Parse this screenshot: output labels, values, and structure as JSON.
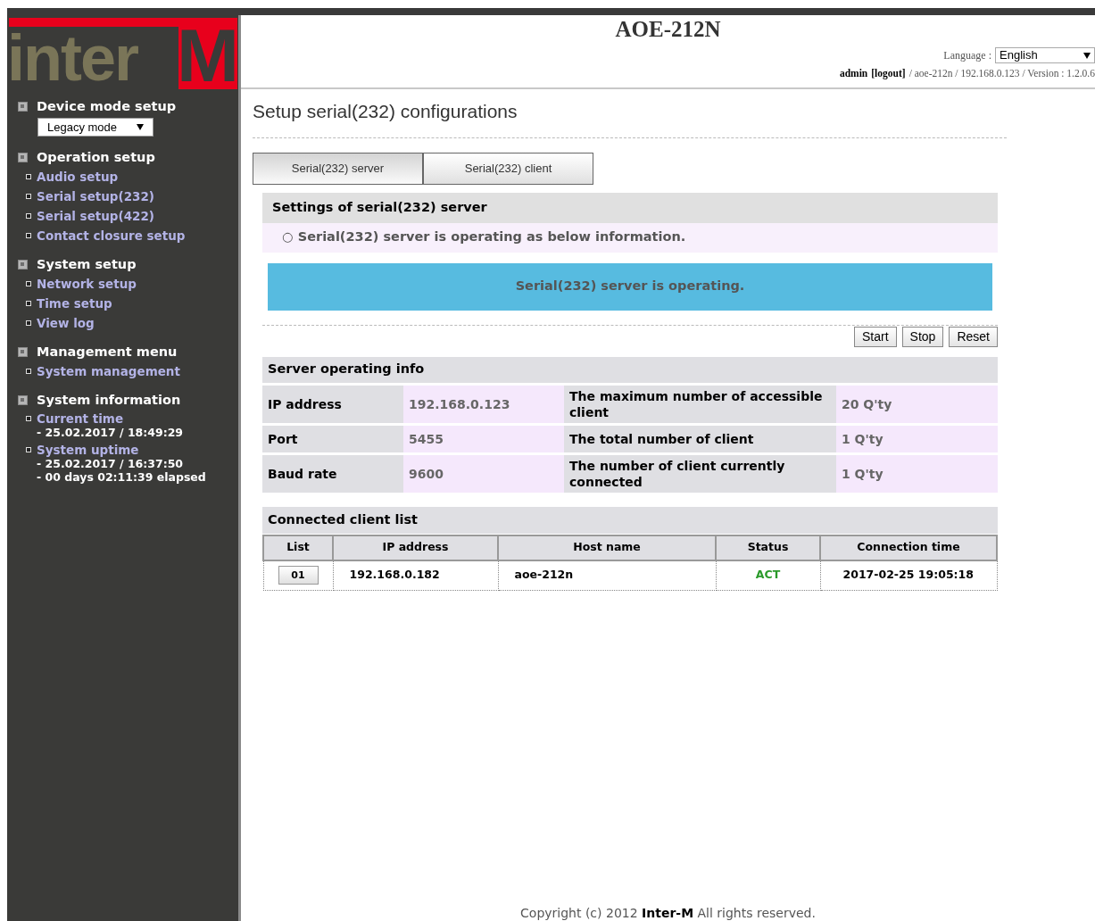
{
  "logo": {
    "text": "inter",
    "accent": "M"
  },
  "sidebar": {
    "sections": [
      {
        "title": "Device mode setup",
        "dropdown": {
          "value": "Legacy mode"
        }
      },
      {
        "title": "Operation setup",
        "items": [
          {
            "kind": "link",
            "label": "Audio setup"
          },
          {
            "kind": "link",
            "label": "Serial setup(232)"
          },
          {
            "kind": "link",
            "label": "Serial setup(422)"
          },
          {
            "kind": "link",
            "label": "Contact closure setup"
          }
        ]
      },
      {
        "title": "System setup",
        "items": [
          {
            "kind": "link",
            "label": "Network setup"
          },
          {
            "kind": "link",
            "label": "Time setup"
          },
          {
            "kind": "link",
            "label": "View log"
          }
        ]
      },
      {
        "title": "Management menu",
        "items": [
          {
            "kind": "link",
            "label": "System management"
          }
        ]
      },
      {
        "title": "System information",
        "items": [
          {
            "kind": "info",
            "label": "Current time",
            "lines": [
              "- 25.02.2017 / 18:49:29"
            ]
          },
          {
            "kind": "info",
            "label": "System uptime",
            "lines": [
              "- 25.02.2017 / 16:37:50",
              "- 00 days 02:11:39 elapsed"
            ]
          }
        ]
      }
    ]
  },
  "header": {
    "title": "AOE-212N",
    "language_label": "Language :",
    "language": "English",
    "user": "admin",
    "logout": "[logout]",
    "info": "/ aoe-212n / 192.168.0.123 / Version : 1.2.0.6"
  },
  "page_title": "Setup serial(232) configurations",
  "tabs": [
    {
      "label": "Serial(232) server",
      "selected": true
    },
    {
      "label": "Serial(232) client",
      "selected": false
    }
  ],
  "settings": {
    "title": "Settings of serial(232) server",
    "note": "○ Serial(232) server is operating as below information.",
    "status": "Serial(232) server is operating."
  },
  "buttons": [
    "Start",
    "Stop",
    "Reset"
  ],
  "info": {
    "title": "Server operating info",
    "rows": [
      [
        "IP address",
        "192.168.0.123",
        "The maximum number of accessible client",
        "20 Q'ty"
      ],
      [
        "Port",
        "5455",
        "The total number of client",
        "1 Q'ty"
      ],
      [
        "Baud rate",
        "9600",
        "The number of client currently connected",
        "1 Q'ty"
      ]
    ]
  },
  "clients": {
    "title": "Connected client list",
    "columns": [
      "List",
      "IP address",
      "Host name",
      "Status",
      "Connection time"
    ],
    "rows": [
      {
        "list": "01",
        "ip": "192.168.0.182",
        "host": "aoe-212n",
        "status": "ACT",
        "active": true,
        "time": "2017-02-25 19:05:18"
      }
    ]
  },
  "footer": {
    "text": "Copyright (c) 2012 **Inter-M** All rights reserved."
  }
}
